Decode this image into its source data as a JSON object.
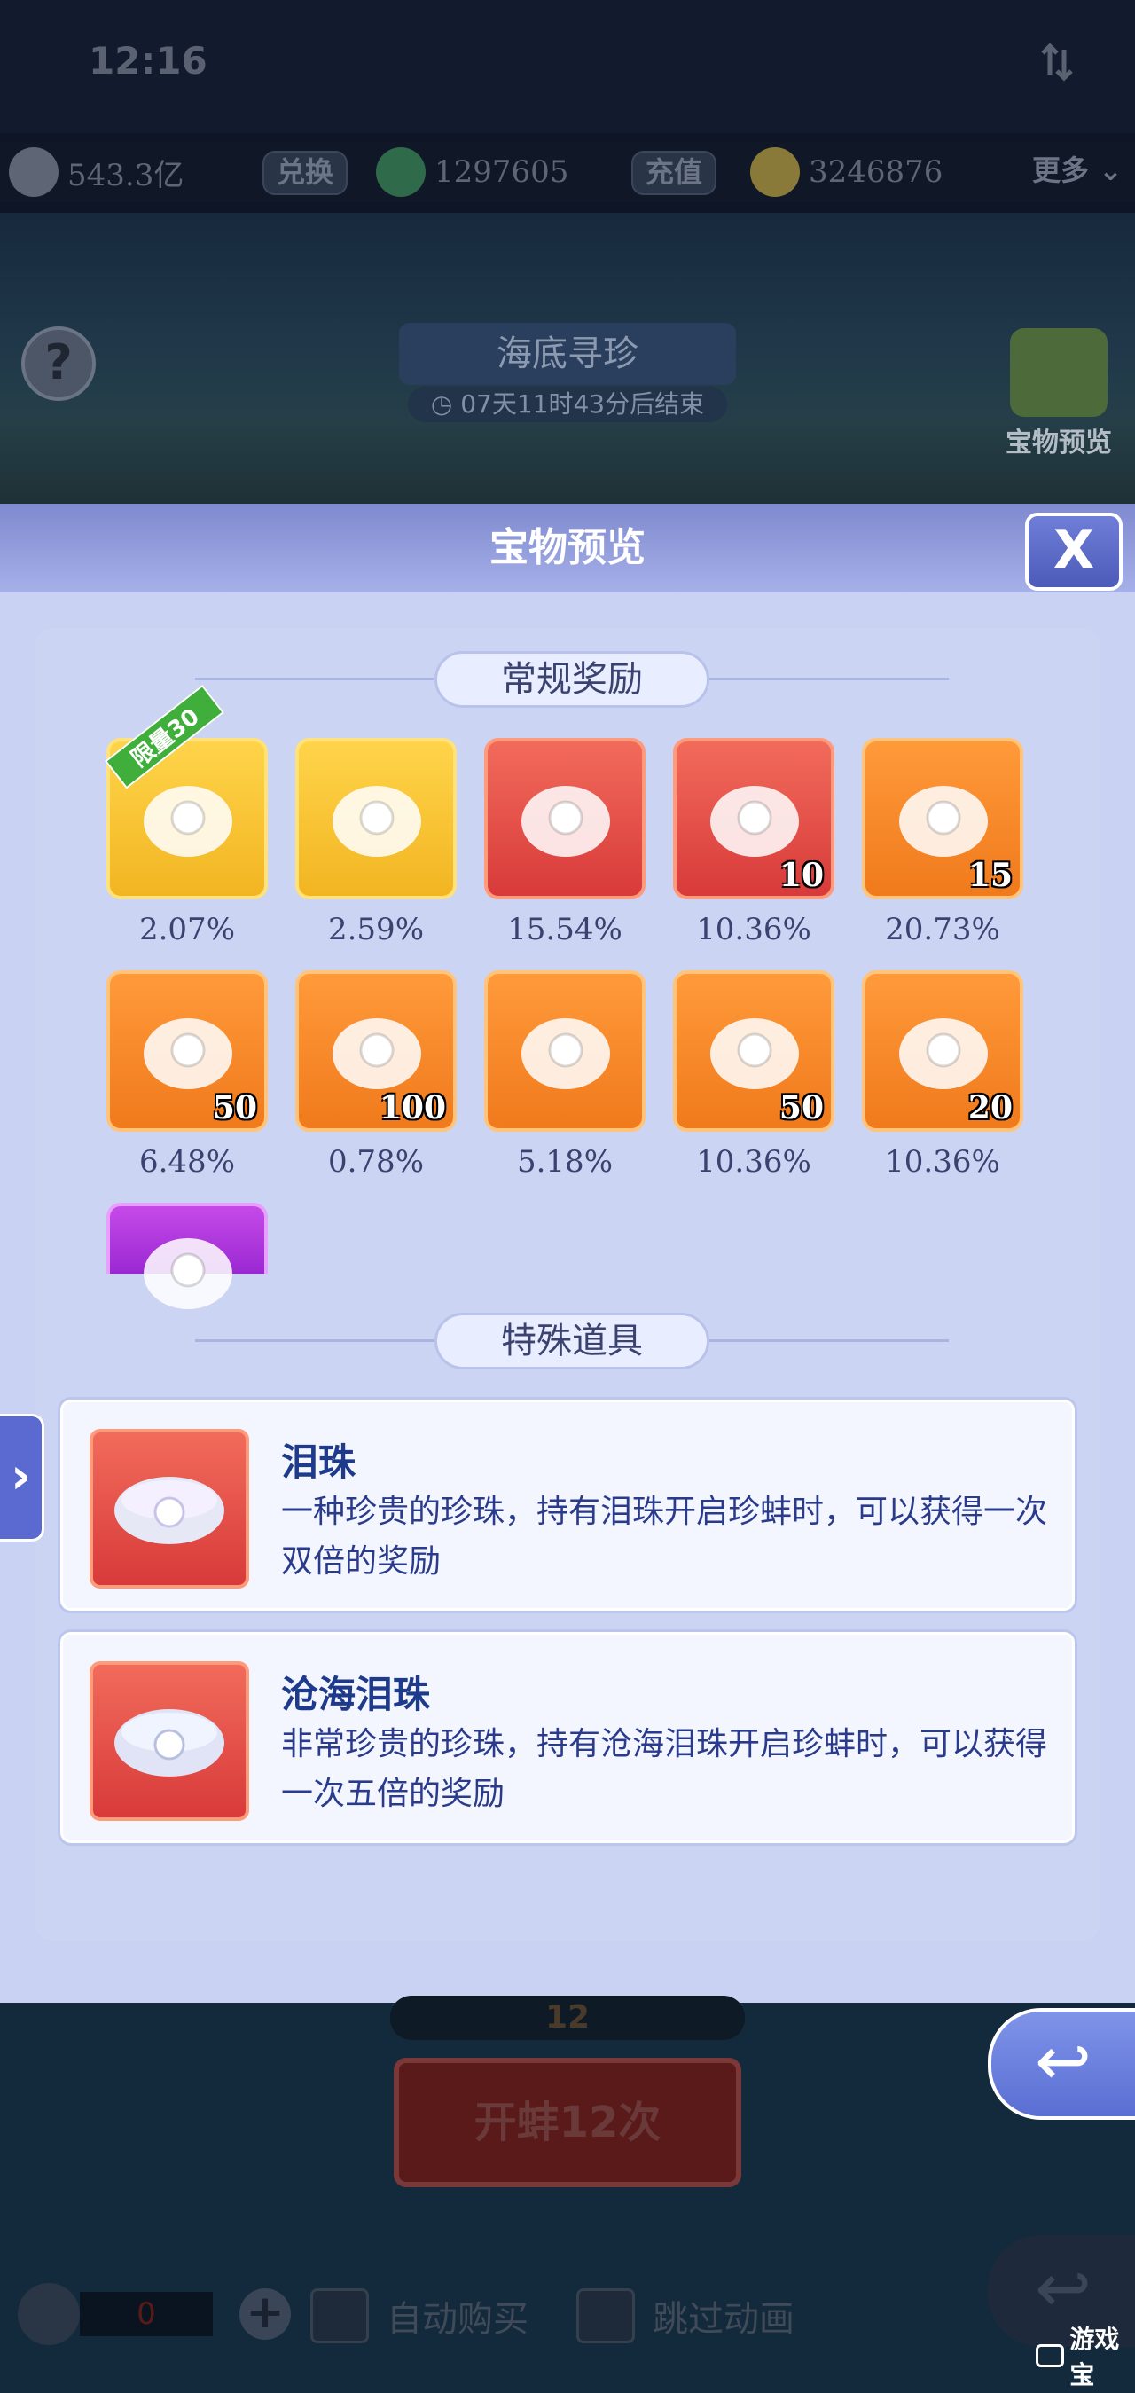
{
  "status_bar": {
    "time": "12:16"
  },
  "currency": {
    "silver": "543.3亿",
    "exchange_label": "兑换",
    "jade": "1297605",
    "recharge_label": "充值",
    "gold": "3246876",
    "more_label": "更多"
  },
  "event": {
    "title": "海底寻珍",
    "timer": "07天11时43分后结束",
    "help_label": "?",
    "treasure_preview_label": "宝物预览"
  },
  "modal": {
    "title": "宝物预览",
    "close_label": "X",
    "regular_section": "常规奖励",
    "special_section": "特殊道具",
    "rewards": [
      {
        "name": "limited-30-item",
        "ribbon": "限量30",
        "count": "",
        "percent": "2.07%",
        "color": "gold"
      },
      {
        "name": "golden-scroll",
        "ribbon": "",
        "count": "",
        "percent": "2.59%",
        "color": "gold"
      },
      {
        "name": "ancient-scroll",
        "ribbon": "",
        "count": "",
        "percent": "15.54%",
        "color": "red"
      },
      {
        "name": "gem-bag",
        "ribbon": "",
        "count": "10",
        "percent": "10.36%",
        "color": "red"
      },
      {
        "name": "pearl-15",
        "ribbon": "",
        "count": "15",
        "percent": "20.73%",
        "color": "orange"
      },
      {
        "name": "pearl-50",
        "ribbon": "",
        "count": "50",
        "percent": "6.48%",
        "color": "orange"
      },
      {
        "name": "pearl-100",
        "ribbon": "",
        "count": "100",
        "percent": "0.78%",
        "color": "orange"
      },
      {
        "name": "map-scroll",
        "ribbon": "",
        "count": "",
        "percent": "5.18%",
        "color": "orange"
      },
      {
        "name": "ore-50",
        "ribbon": "",
        "count": "50",
        "percent": "10.36%",
        "color": "orange"
      },
      {
        "name": "crystal-20",
        "ribbon": "",
        "count": "20",
        "percent": "10.36%",
        "color": "orange"
      },
      {
        "name": "purple-egg",
        "ribbon": "",
        "count": "",
        "percent": "",
        "color": "purple"
      }
    ],
    "special_items": [
      {
        "name": "泪珠",
        "desc": "一种珍贵的珍珠，持有泪珠开启珍蚌时，可以获得一次双倍的奖励"
      },
      {
        "name": "沧海泪珠",
        "desc": "非常珍贵的珍珠，持有沧海泪珠开启珍蚌时，可以获得一次五倍的奖励"
      }
    ]
  },
  "bottom": {
    "count": "12",
    "open_label": "开蚌12次",
    "stepper_value": "0",
    "auto_buy_label": "自动购买",
    "skip_anim_label": "跳过动画",
    "watermark": "游戏宝"
  },
  "colors": {
    "accent": "#5a6ad0",
    "text_primary": "#3a4270",
    "card_title": "#1e3a8a"
  }
}
